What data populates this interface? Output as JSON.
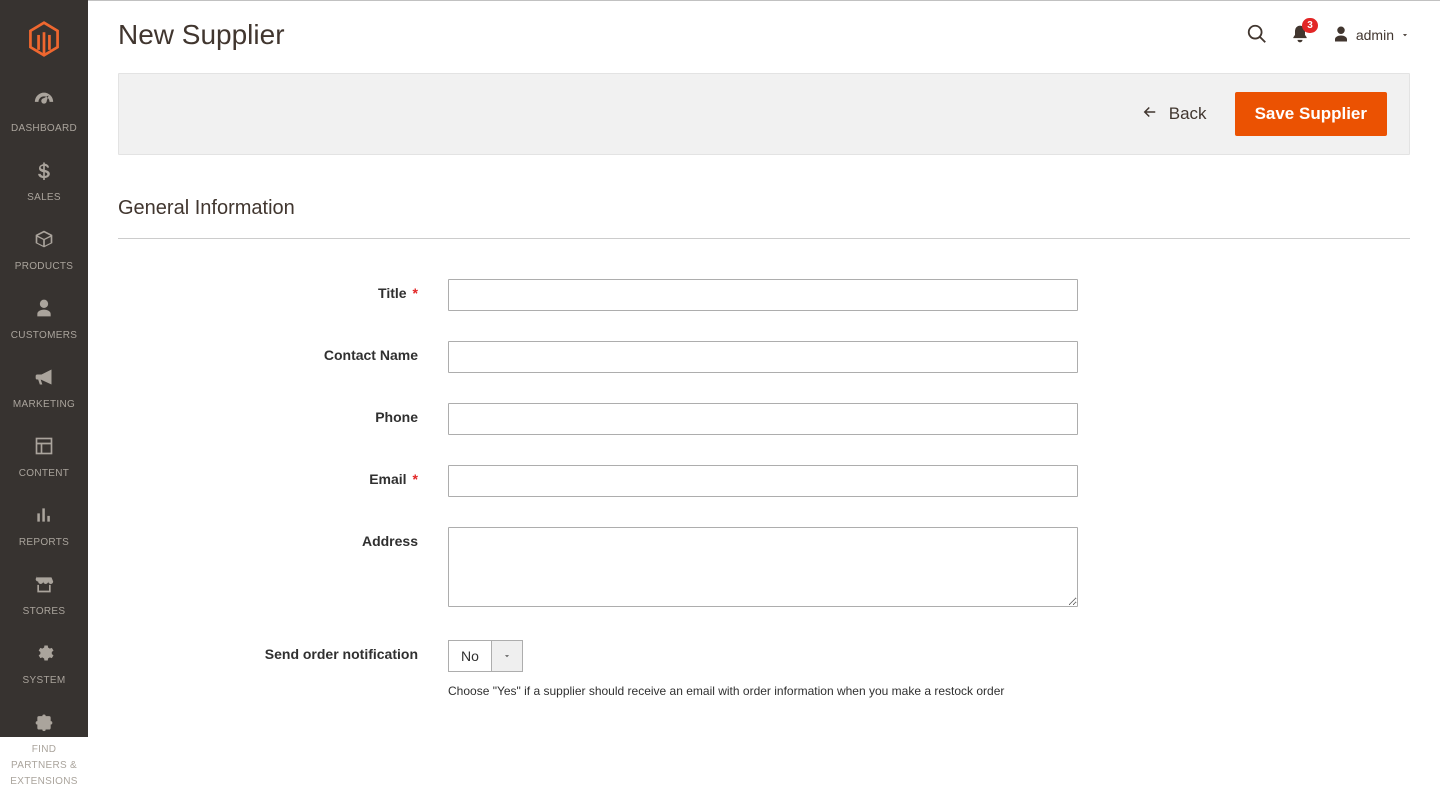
{
  "sidebar": {
    "items": [
      {
        "label": "DASHBOARD"
      },
      {
        "label": "SALES"
      },
      {
        "label": "PRODUCTS"
      },
      {
        "label": "CUSTOMERS"
      },
      {
        "label": "MARKETING"
      },
      {
        "label": "CONTENT"
      },
      {
        "label": "REPORTS"
      },
      {
        "label": "STORES"
      },
      {
        "label": "SYSTEM"
      },
      {
        "label": "FIND PARTNERS & EXTENSIONS"
      }
    ]
  },
  "header": {
    "title": "New Supplier",
    "notification_count": "3",
    "admin_label": "admin"
  },
  "actions": {
    "back_label": "Back",
    "save_label": "Save Supplier"
  },
  "form": {
    "section_title": "General Information",
    "fields": {
      "title": {
        "label": "Title",
        "required": true,
        "value": ""
      },
      "contact": {
        "label": "Contact Name",
        "required": false,
        "value": ""
      },
      "phone": {
        "label": "Phone",
        "required": false,
        "value": ""
      },
      "email": {
        "label": "Email",
        "required": true,
        "value": ""
      },
      "address": {
        "label": "Address",
        "required": false,
        "value": ""
      },
      "notify": {
        "label": "Send order notification",
        "required": false,
        "value": "No",
        "help": "Choose \"Yes\" if a supplier should receive an email with order information when you make a restock order"
      }
    }
  }
}
